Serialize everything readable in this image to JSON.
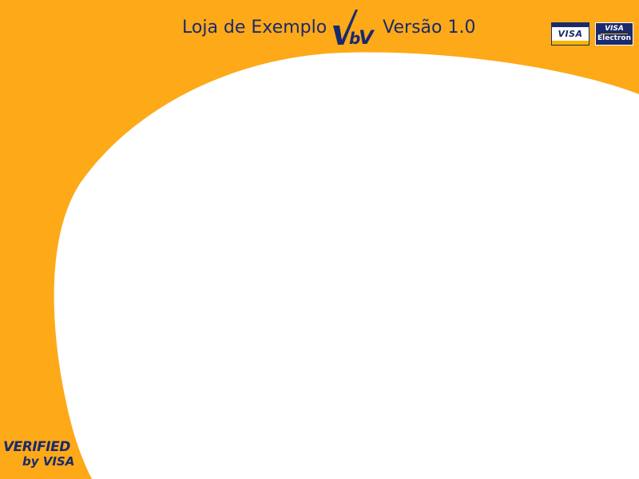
{
  "header": {
    "store_name": "Loja de Exemplo",
    "logo_text": "VbV",
    "version": "Versão 1.0"
  },
  "cards": {
    "visa": "VISA",
    "electron_brand": "VISA",
    "electron_label": "Electron"
  },
  "footer": {
    "line1": "VERIFIED",
    "line2": "by VISA"
  },
  "colors": {
    "background": "#FDA918",
    "content": "#FFFFFF",
    "brand_blue": "#1A2A6C",
    "visa_gold": "#F7B600"
  },
  "icons": [
    "vbv-logo",
    "visa-card-icon",
    "visa-electron-card-icon",
    "verified-by-visa-logo"
  ]
}
